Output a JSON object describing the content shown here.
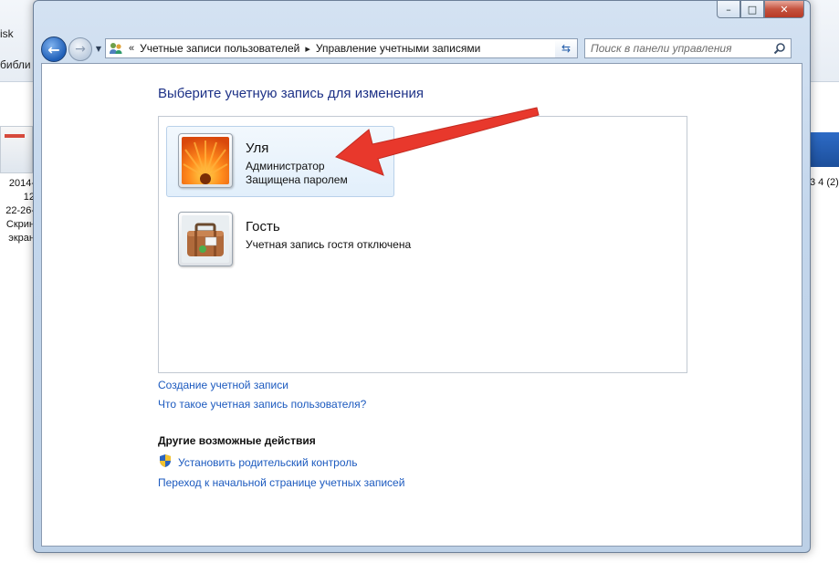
{
  "background": {
    "left_crumb_1": "isk",
    "left_crumb_2": "библи",
    "left_file_label": [
      "2014-12",
      "22-26-",
      "Скрин",
      "экран"
    ],
    "right_file_label": "3 4 (2)"
  },
  "window": {
    "minimize_glyph": "–",
    "maximize_glyph": "□",
    "close_glyph": "✕",
    "back_glyph": "←",
    "forward_glyph": "→",
    "address": {
      "overflow": "«",
      "crumb_1": "Учетные записи пользователей",
      "crumb_2": "Управление учетными записями",
      "separator": "▸"
    },
    "search": {
      "placeholder": "Поиск в панели управления"
    }
  },
  "main": {
    "title": "Выберите учетную запись для изменения",
    "accounts": [
      {
        "name": "Уля",
        "line1": "Администратор",
        "line2": "Защищена паролем",
        "picture": "orange-flower"
      },
      {
        "name": "Гость",
        "line1": "Учетная запись гостя отключена",
        "picture": "suitcase"
      }
    ],
    "links": {
      "create": "Создание учетной записи",
      "what_is": "Что такое учетная запись пользователя?"
    },
    "other_actions": {
      "heading": "Другие возможные действия",
      "parental": "Установить родительский контроль",
      "home": "Переход к начальной странице учетных записей"
    }
  },
  "colors": {
    "link": "#1c5abf",
    "title": "#1e3287",
    "arrow": "#e8382c"
  },
  "icons": [
    "back-icon",
    "forward-icon",
    "users-icon",
    "refresh-icon",
    "search-icon",
    "shield-icon"
  ]
}
